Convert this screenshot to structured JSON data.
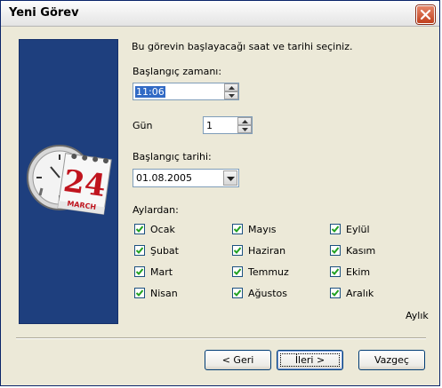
{
  "window": {
    "title": "Yeni Görev"
  },
  "intro": "Bu görevin başlayacağı saat ve tarihi seçiniz.",
  "start_time": {
    "label": "Başlangıç zamanı:",
    "value": "11:06"
  },
  "day": {
    "label": "Gün",
    "value": "1"
  },
  "start_date": {
    "label": "Başlangıç tarihi:",
    "value": "01.08.2005"
  },
  "months": {
    "label": "Aylardan:",
    "items": [
      {
        "label": "Ocak",
        "checked": true
      },
      {
        "label": "Mayıs",
        "checked": true
      },
      {
        "label": "Eylül",
        "checked": true
      },
      {
        "label": "Şubat",
        "checked": true
      },
      {
        "label": "Haziran",
        "checked": true
      },
      {
        "label": "Kasım",
        "checked": true
      },
      {
        "label": "Mart",
        "checked": true
      },
      {
        "label": "Temmuz",
        "checked": true
      },
      {
        "label": "Ekim",
        "checked": true
      },
      {
        "label": "Nisan",
        "checked": true
      },
      {
        "label": "Ağustos",
        "checked": true
      },
      {
        "label": "Aralık",
        "checked": true
      }
    ]
  },
  "schedule_type": "Aylık",
  "buttons": {
    "back": "< Geri",
    "next": "İleri >",
    "cancel": "Vazgeç"
  },
  "illustration": {
    "calendar_day": "24",
    "calendar_month": "MARCH"
  },
  "colors": {
    "side_panel": "#1e3f7e",
    "calendar_red": "#c0141e",
    "close_button": "#c0401e"
  }
}
